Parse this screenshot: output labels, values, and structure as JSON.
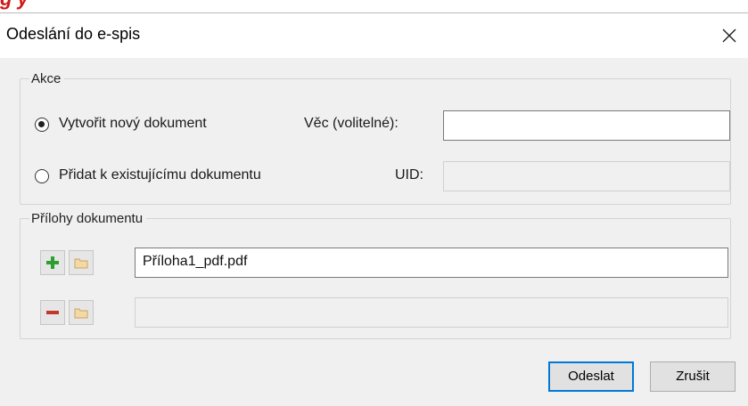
{
  "background_caption": "g                                        y",
  "window": {
    "title": "Odeslání do e-spis",
    "close_icon": "close-icon"
  },
  "akce": {
    "label": "Akce",
    "option_new": {
      "label": "Vytvořit nový dokument",
      "selected": true
    },
    "vec_label": "Věc (volitelné):",
    "vec_value": "",
    "option_existing": {
      "label": "Přidat k existujícímu dokumentu",
      "selected": false
    },
    "uid_label": "UID:",
    "uid_value": ""
  },
  "prilohy": {
    "label": "Přílohy dokumentu",
    "rows": [
      {
        "action_icon": "plus-icon",
        "folder_icon": "folder-icon",
        "value": "Příloha1_pdf.pdf"
      },
      {
        "action_icon": "minus-icon",
        "folder_icon": "folder-icon",
        "value": ""
      }
    ]
  },
  "buttons": {
    "send": "Odeslat",
    "cancel": "Zrušit"
  },
  "colors": {
    "accent": "#0078d7",
    "plus": "#2e9e2e",
    "minus": "#c0392b",
    "caption": "#d01818"
  }
}
